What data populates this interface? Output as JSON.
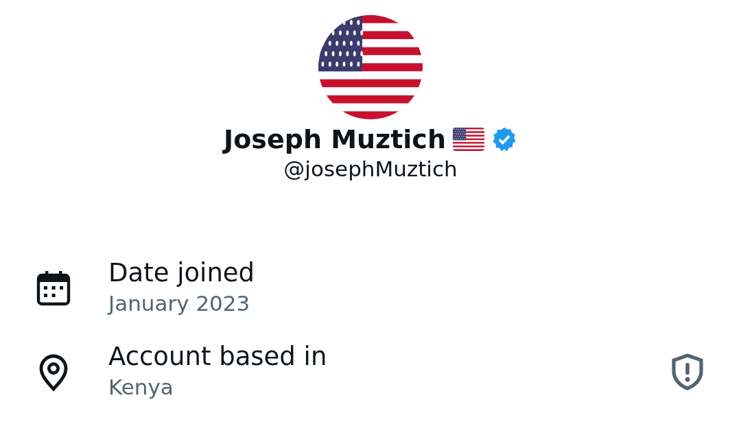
{
  "profile": {
    "name": "Joseph Muztich",
    "handle": "@josephMuztich",
    "verified": true
  },
  "details": [
    {
      "kind": "date",
      "label": "Date joined",
      "value": "January 2023",
      "warning": false
    },
    {
      "kind": "location",
      "label": "Account based in",
      "value": "Kenya",
      "warning": true
    }
  ]
}
